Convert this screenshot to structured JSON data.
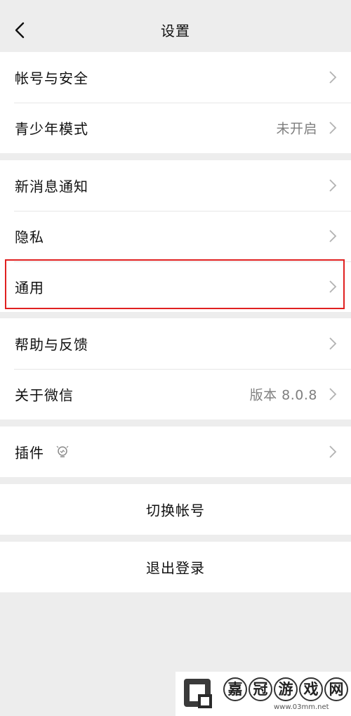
{
  "header": {
    "title": "设置"
  },
  "groups": {
    "account": [
      {
        "label": "帐号与安全",
        "value": ""
      },
      {
        "label": "青少年模式",
        "value": "未开启"
      }
    ],
    "notify": [
      {
        "label": "新消息通知",
        "value": ""
      },
      {
        "label": "隐私",
        "value": ""
      },
      {
        "label": "通用",
        "value": ""
      }
    ],
    "about": [
      {
        "label": "帮助与反馈",
        "value": ""
      },
      {
        "label": "关于微信",
        "value": "版本 8.0.8"
      }
    ],
    "plugins": [
      {
        "label": "插件",
        "value": ""
      }
    ]
  },
  "actions": {
    "switch_account": "切换帐号",
    "logout": "退出登录"
  },
  "watermark": {
    "chars": [
      "嘉",
      "冠",
      "游",
      "戏",
      "网"
    ],
    "url": "www.03mm.net"
  },
  "colors": {
    "background": "#ededed",
    "highlight": "#e02020"
  }
}
